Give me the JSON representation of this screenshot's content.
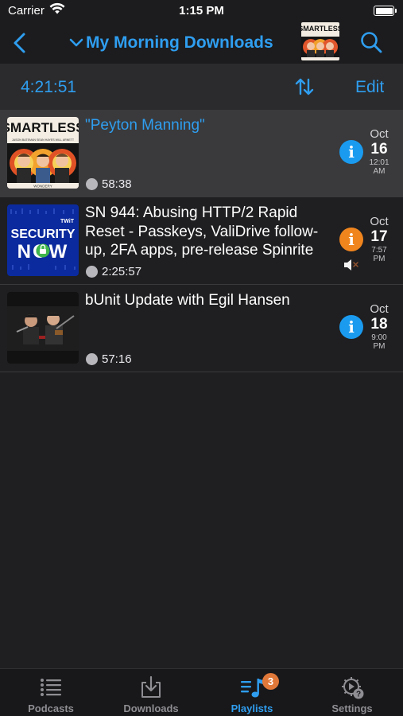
{
  "status_bar": {
    "carrier": "Carrier",
    "time": "1:15 PM"
  },
  "nav": {
    "title": "My Morning Downloads",
    "accent_color": "#2f9ef0"
  },
  "toolbar": {
    "total_duration": "4:21:51",
    "edit_label": "Edit"
  },
  "episodes": [
    {
      "title": "\"Peyton Manning\"",
      "duration": "58:38",
      "date_month": "Oct",
      "date_day": "16",
      "date_time": "12:01 AM",
      "info_color": "#1a9bf0",
      "artwork": "smartless-art",
      "art_text": {
        "brand": "SMARTLESS",
        "hosts": "JASON BATEMAN  SEAN HAYES  WILL ARNETT",
        "network": "WONDERY"
      }
    },
    {
      "title": "SN 944: Abusing HTTP/2 Rapid Reset - Passkeys, ValiDrive follow-up, 2FA apps, pre-release Spinrite",
      "duration": "2:25:57",
      "date_month": "Oct",
      "date_day": "17",
      "date_time": "7:57 PM",
      "info_color": "#f0851e",
      "artwork": "security-now-art",
      "art_text": {
        "network": "TWiT",
        "line1": "SECURITY",
        "line2": "NOW"
      }
    },
    {
      "title": "bUnit Update with Egil Hansen",
      "duration": "57:16",
      "date_month": "Oct",
      "date_day": "18",
      "date_time": "9:00 PM",
      "info_color": "#1a9bf0",
      "artwork": "bunit-art"
    }
  ],
  "tabs": [
    {
      "label": "Podcasts",
      "icon": "list-icon"
    },
    {
      "label": "Downloads",
      "icon": "download-tray-icon"
    },
    {
      "label": "Playlists",
      "icon": "playlist-music-icon",
      "badge": "3"
    },
    {
      "label": "Settings",
      "icon": "gear-play-icon"
    }
  ]
}
